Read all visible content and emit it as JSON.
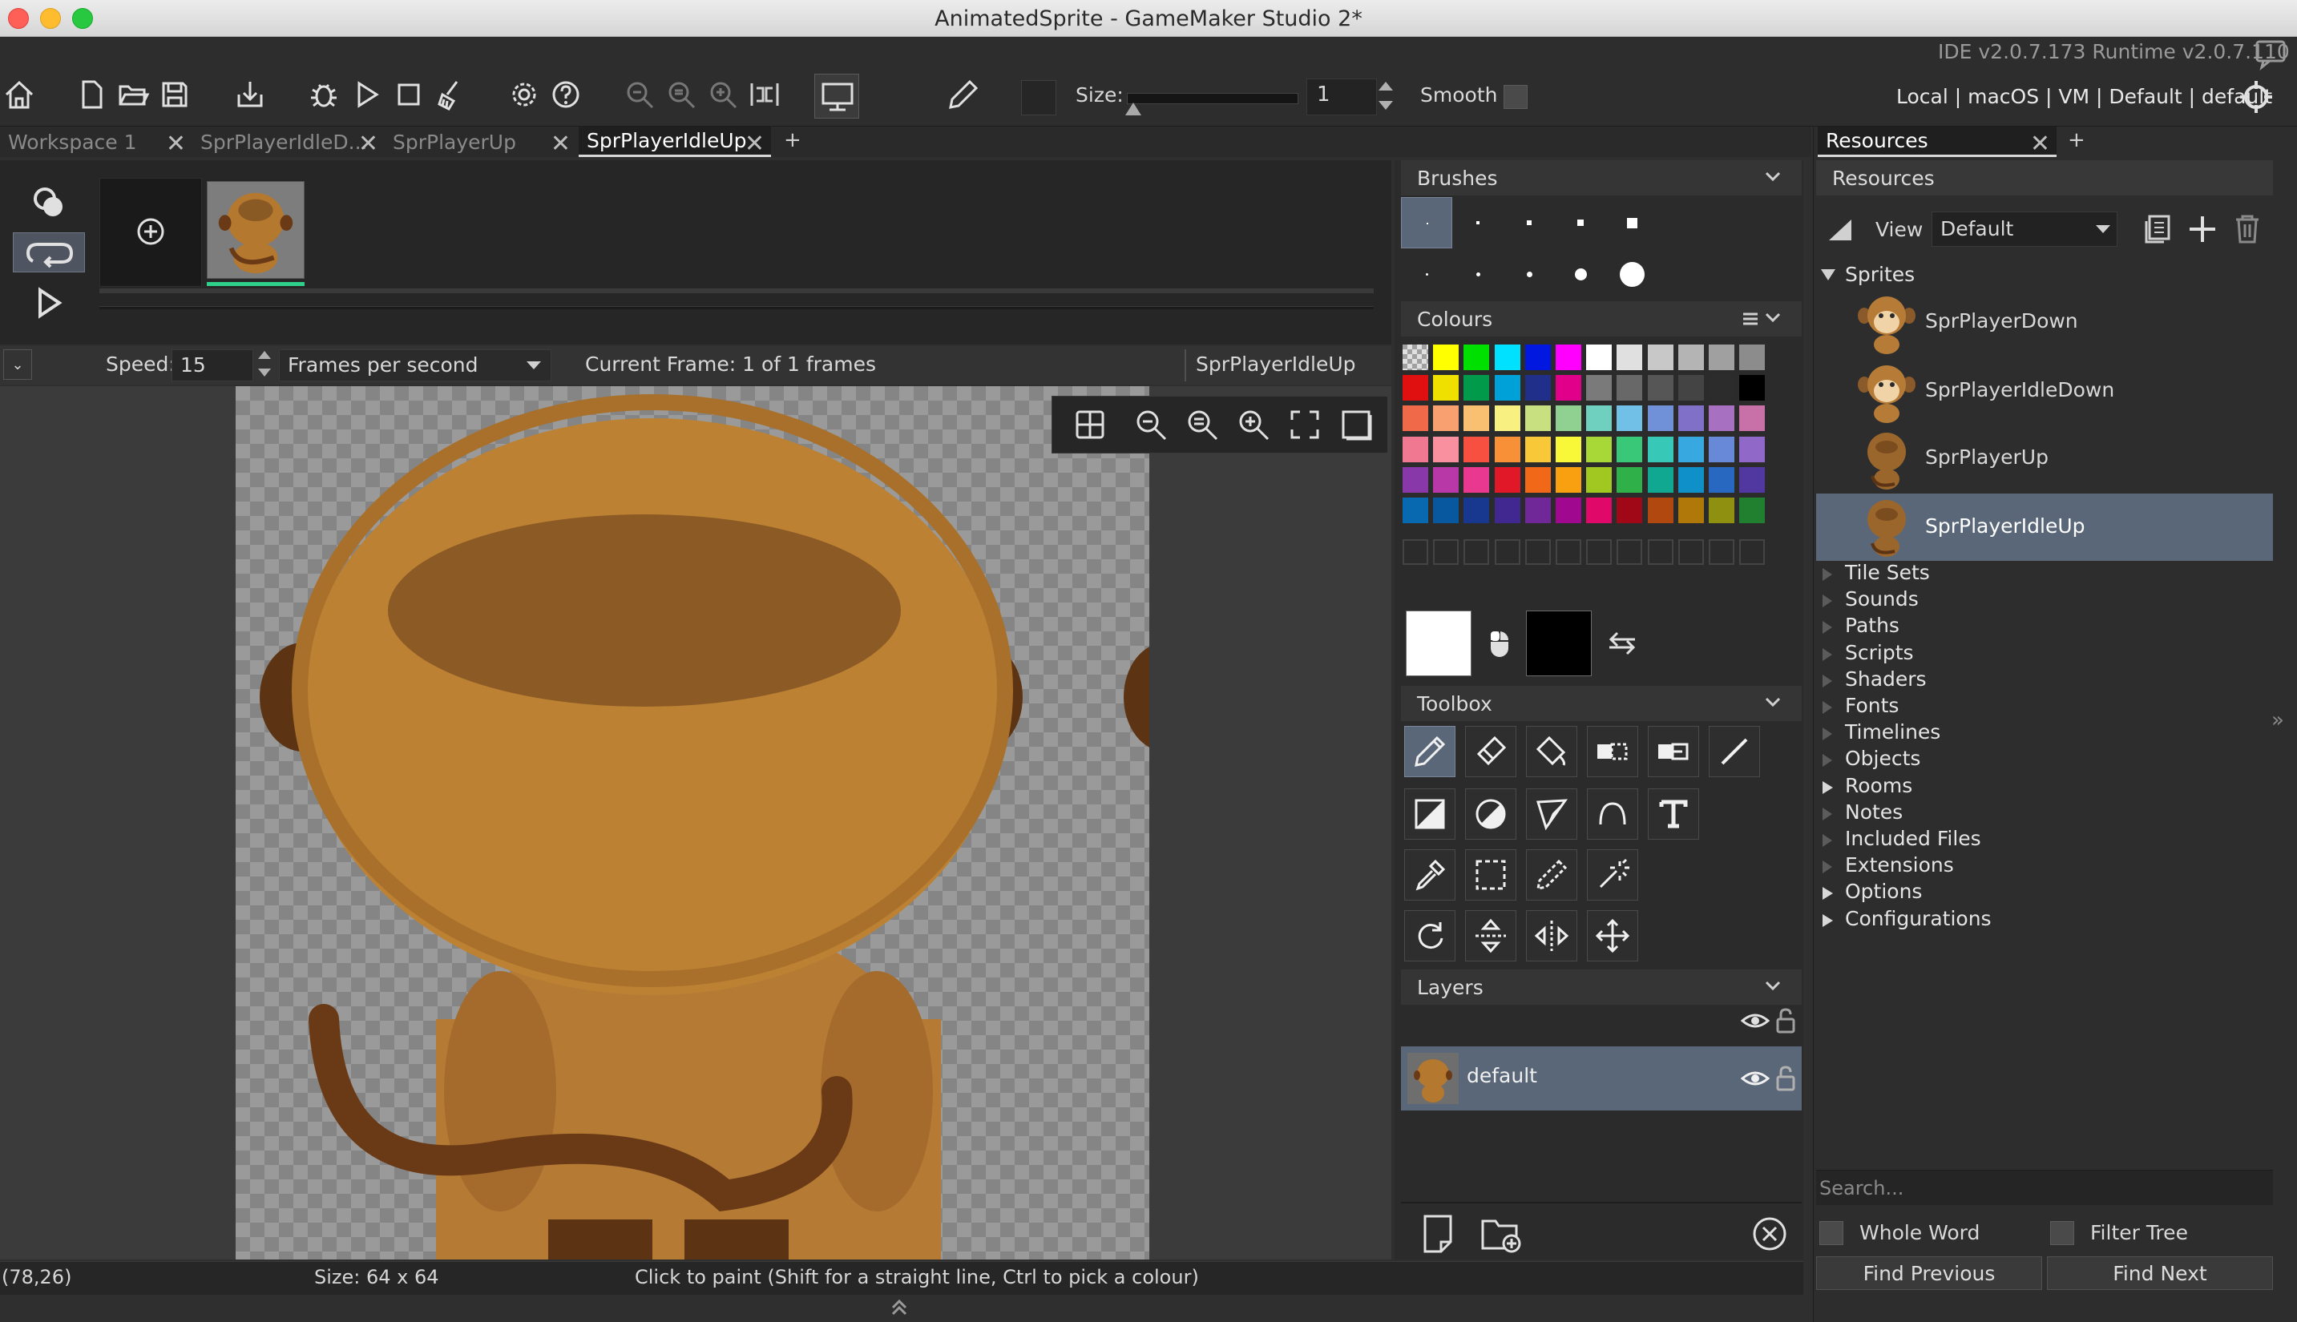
{
  "window": {
    "title": "AnimatedSprite - GameMaker Studio 2*"
  },
  "toolbar": {
    "size_label": "Size:",
    "size_value": "1",
    "smooth_label": "Smooth",
    "ide_version": "IDE v2.0.7.173 Runtime v2.0.7.110",
    "target": "Local | macOS | VM | Default | default"
  },
  "tabs": [
    {
      "label": "Workspace 1"
    },
    {
      "label": "SprPlayerIdleD..."
    },
    {
      "label": "SprPlayerUp"
    },
    {
      "label": "SprPlayerIdleUp"
    }
  ],
  "add_tab": "+",
  "frames_bar": {
    "speed_label": "Speed:",
    "speed_value": "15",
    "speed_unit": "Frames per second",
    "current_frame": "Current Frame: 1 of 1 frames",
    "sprite_name": "SprPlayerIdleUp"
  },
  "panels": {
    "brushes": "Brushes",
    "colours": "Colours",
    "toolbox": "Toolbox",
    "layers": "Layers"
  },
  "layers": [
    {
      "name": "default"
    }
  ],
  "palette_colors": [
    [
      "#d0d0d0",
      "#ffff00",
      "#00e000",
      "#00e0ff",
      "#0018e0",
      "#ff00ff",
      "#ffffff",
      "#e0e0e0",
      "#c8c8c8",
      "#b4b4b4",
      "#a0a0a0",
      "#8c8c8c"
    ],
    [
      "#e01010",
      "#f0e000",
      "#009a4a",
      "#00a0d8",
      "#20308a",
      "#e0008a",
      "#7a7a7a",
      "#686868",
      "#565656",
      "#444444",
      "#2c2c2c",
      "#000000"
    ],
    [
      "#f06a4a",
      "#f8a070",
      "#f8c070",
      "#f8f080",
      "#c8e080",
      "#90d090",
      "#70d0c0",
      "#70c0e8",
      "#7090d8",
      "#8070c8",
      "#a870c0",
      "#c870a8"
    ],
    [
      "#f07890",
      "#f890a0",
      "#f85040",
      "#f89038",
      "#f8c838",
      "#f8f838",
      "#a8d838",
      "#38c878",
      "#38c8b8",
      "#38a8e0",
      "#6888d8",
      "#9068c8"
    ],
    [
      "#8838a8",
      "#b838a8",
      "#e83890",
      "#e01828",
      "#f06818",
      "#f8a010",
      "#a0c820",
      "#30b048",
      "#10a890",
      "#1090c8",
      "#2868c0",
      "#5038a0"
    ],
    [
      "#0868b0",
      "#0858a0",
      "#183890",
      "#402890",
      "#702898",
      "#a00890",
      "#e00868",
      "#a00818",
      "#b04810",
      "#b07808",
      "#909010",
      "#208030"
    ]
  ],
  "colors": {
    "primary": "#ffffff",
    "secondary": "#000000",
    "accent_selected": "#5a6778"
  },
  "resources": {
    "tab_label": "Resources",
    "header": "Resources",
    "view_label": "View",
    "view_value": "Default",
    "sprites_label": "Sprites",
    "sprites": [
      {
        "name": "SprPlayerDown"
      },
      {
        "name": "SprPlayerIdleDown"
      },
      {
        "name": "SprPlayerUp"
      },
      {
        "name": "SprPlayerIdleUp"
      }
    ],
    "categories": [
      {
        "label": "Tile Sets",
        "expandable": false
      },
      {
        "label": "Sounds",
        "expandable": false
      },
      {
        "label": "Paths",
        "expandable": false
      },
      {
        "label": "Scripts",
        "expandable": false
      },
      {
        "label": "Shaders",
        "expandable": false
      },
      {
        "label": "Fonts",
        "expandable": false
      },
      {
        "label": "Timelines",
        "expandable": false
      },
      {
        "label": "Objects",
        "expandable": false
      },
      {
        "label": "Rooms",
        "expandable": true
      },
      {
        "label": "Notes",
        "expandable": false
      },
      {
        "label": "Included Files",
        "expandable": false
      },
      {
        "label": "Extensions",
        "expandable": false
      },
      {
        "label": "Options",
        "expandable": true
      },
      {
        "label": "Configurations",
        "expandable": true
      }
    ],
    "search_placeholder": "Search...",
    "whole_word": "Whole Word",
    "filter_tree": "Filter Tree",
    "find_previous": "Find Previous",
    "find_next": "Find Next"
  },
  "status": {
    "coords": "(78,26)",
    "size": "Size: 64 x 64",
    "hint": "Click to paint (Shift for a straight line, Ctrl to pick a colour)"
  }
}
